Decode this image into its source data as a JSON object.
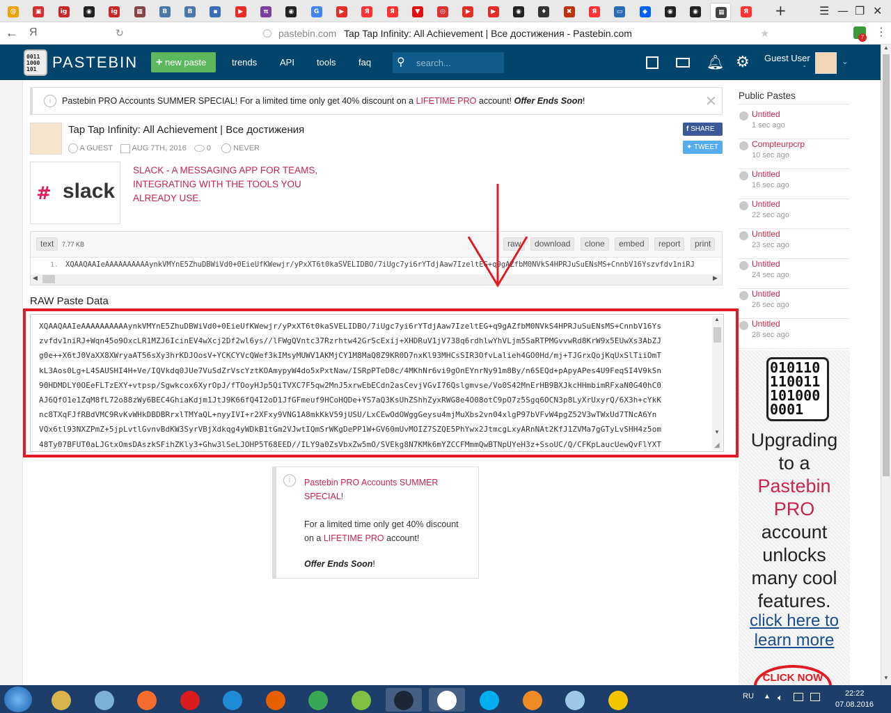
{
  "browser": {
    "tab_icons": [
      "orbit",
      "gift",
      "ig",
      "steam",
      "ig",
      "mosaic",
      "vk",
      "vk",
      "chat",
      "youtube",
      "pi",
      "steam",
      "translate",
      "youtube",
      "yandex",
      "yandex",
      "shield",
      "target",
      "youtube",
      "youtube",
      "steam",
      "wot",
      "dota",
      "yandex",
      "tv",
      "dropbox",
      "steam",
      "steam",
      "pastebin-active",
      "yandex"
    ],
    "address_domain": "pastebin.com",
    "address_title": "Tap Tap Infinity: All Achievement | Все достижения - Pastebin.com",
    "yandex_glyph": "Я",
    "ext_badge": "7"
  },
  "header": {
    "logo_text": "PASTEBIN",
    "logo_digits": [
      "0011",
      "1000",
      "101"
    ],
    "new_paste": "new paste",
    "nav": [
      "trends",
      "API",
      "tools",
      "faq"
    ],
    "search_placeholder": "search...",
    "user_label": "Guest User",
    "user_dash": "-"
  },
  "promo": {
    "prefix": "Pastebin PRO Accounts SUMMER SPECIAL! For a limited time only get ",
    "discount": "40% discount",
    "mid": " on a ",
    "lifetime": "LIFETIME PRO",
    "after": " account! ",
    "ends": "Offer Ends Soon",
    "bang": "!"
  },
  "paste": {
    "title": "Tap Tap Infinity: All Achievement | Все достижения",
    "author": "A GUEST",
    "date": "AUG 7TH, 2016",
    "views": "0",
    "expires": "NEVER",
    "share": "SHARE",
    "tweet": "TWEET",
    "format": "text",
    "size": "7.77 KB",
    "actions": [
      "raw",
      "download",
      "clone",
      "embed",
      "report",
      "print"
    ],
    "line_no": "1.",
    "line_text": "XQAAQAAIeAAAAAAAAAAynkVMYnE5ZhuDBWiVd0+0EieUfKWewjr/yPxXT6t0kaSVELIDBO/7iUgc7yi6rYTdjAaw7IzeltEG+q9gAZfbM0NVkS4HPRJuSuENsMS+CnnbV16Yszvfdv1niRJ"
  },
  "ad": {
    "slack_word": "slack",
    "headline": [
      "SLACK - A MESSAGING APP FOR TEAMS,",
      "INTEGRATING WITH THE TOOLS YOU",
      "ALREADY USE."
    ]
  },
  "raw": {
    "heading": "RAW Paste Data",
    "lines": [
      "XQAAQAAIeAAAAAAAAAAynkVMYnE5ZhuDBWiVd0+0EieUfKWewjr/yPxXT6t0kaSVELIDBO/7iUgc7yi6rYTdjAaw7IzeltEG+q9gAZfbM0NVkS4HPRJuSuENsMS+CnnbV16Ys",
      "zvfdv1niRJ+Wqn45o9OxcLR1MZJ6IcinEV4wXcj2Df2wl6ys//lFWgQVntc37Rzrhtw42GrScExij+XHDRuV1jV738q6rdhlwYhVLjm5SaRTPMGvvwRd8KrW9x5EUwXs3AbZJ",
      "g0e++X6tJ0VaXX8XWryaAT56sXy3hrKDJOosV+YCKCYVcQWef3kIMsyMUWV1AKMjCY1M8MaQ8Z9KR0D7nxKl93MHCsSIR3OfvLalieh4GO0Hd/mj+TJGrxQojKqUxSlTiiOmT",
      "kL3Aos0Lg+L4SAUSHI4H+Ve/IQVkdq0JUe7VuSdZrVscYztKOAmypyW4do5xPxtNaw/ISRpPTeD8c/4MKhNr6vi9gOnEYnrNy91m8By/n6SEQd+pApyAPes4U9FeqSI4V9kSn",
      "90HDMDLY0OEeFLTzEXY+vtpsp/Sgwkcox6XyrOpJ/fTOoyHJp5QiTVXC7F5qw2MnJ5xrwEbECdn2asCevjVGvI76Qslgmvse/Vo0S42MnErHB9BXJkcHHmbimRFxaN0G40hC0",
      "AJ6QfO1e1ZqM8fL72o88zWy6BEC4GhiaKdjm1JtJ9K66fQ4I2oD1JfGFmeuf9HCoHQDe+YS7aQ3KsUhZShhZyxRWG8e4O08otC9pO7z5Sgq6OCN3p8LyXrUxyrQ/6X3h+cYkK",
      "nc8TXqFJfRBdVMC9RvKvWHkDBDBRrxlTMYaQL+nyyIVI+r2XFxy9VNG1A8mkKkV59jUSU/LxCEwOdOWggGeysu4mjMuXbs2vn04xlgP97bVFvW4pgZ52V3wTWxUd7TNcA6Yn",
      "VQx6tl93NXZPmZ+5jpLvtlGvnvBdKW3SyrVBjXdkqg4yWDkB1tGm2VJwtIQmSrWKgDePP1W+GV60mUvMOIZ7SZQE5PhYwx2JtmcgLxyARnNAt2KfJ1ZVMa7gGTyLvSHH4z5om",
      "48Ty07BFUT0aLJGtxOmsDAszkSFihZKly3+Ghw3lSeLJOHP5T68EED//ILY9a0ZsVbxZw5mO/SVEkg8N7KMk6mYZCCFMmmQwBTNpUYeH3z+SsoUC/Q/CFKpLaucUewQvFlYXT"
    ]
  },
  "promo_box": {
    "title": "Pastebin PRO Accounts SUMMER SPECIAL!",
    "line1_a": "For a limited time only get ",
    "line1_b": "40% discount",
    "line2_a": "on a ",
    "line2_b": "LIFETIME PRO",
    "line2_c": " account!",
    "ends": "Offer Ends Soon",
    "bang": "!"
  },
  "sidebar": {
    "heading": "Public Pastes",
    "items": [
      {
        "title": "Untitled",
        "time": "1 sec ago"
      },
      {
        "title": "Compteurpcrp",
        "time": "10 sec ago"
      },
      {
        "title": "Untitled",
        "time": "16 sec ago"
      },
      {
        "title": "Untitled",
        "time": "22 sec ago"
      },
      {
        "title": "Untitled",
        "time": "23 sec ago"
      },
      {
        "title": "Untitled",
        "time": "24 sec ago"
      },
      {
        "title": "Untitled",
        "time": "26 sec ago"
      },
      {
        "title": "Untitled",
        "time": "28 sec ago"
      }
    ],
    "ad_digits": [
      "010110",
      "110011",
      "101000",
      "0001"
    ],
    "ad_lines": [
      "Upgrading",
      "to a"
    ],
    "ad_pro": "Pastebin PRO",
    "ad_lines2": [
      "account",
      "unlocks",
      "many cool",
      "features."
    ],
    "ad_link": [
      "click here to",
      "learn more"
    ],
    "ad_stamp": "CLICK NOW"
  },
  "taskbar": {
    "lang": "RU",
    "time": "22:22",
    "date": "07.08.2016"
  },
  "colors": {
    "header_bg": "#02456c",
    "green": "#5cb85c",
    "pink": "#c7254e",
    "red_box": "#e11b22",
    "facebook": "#3b5998",
    "twitter": "#55acee"
  }
}
